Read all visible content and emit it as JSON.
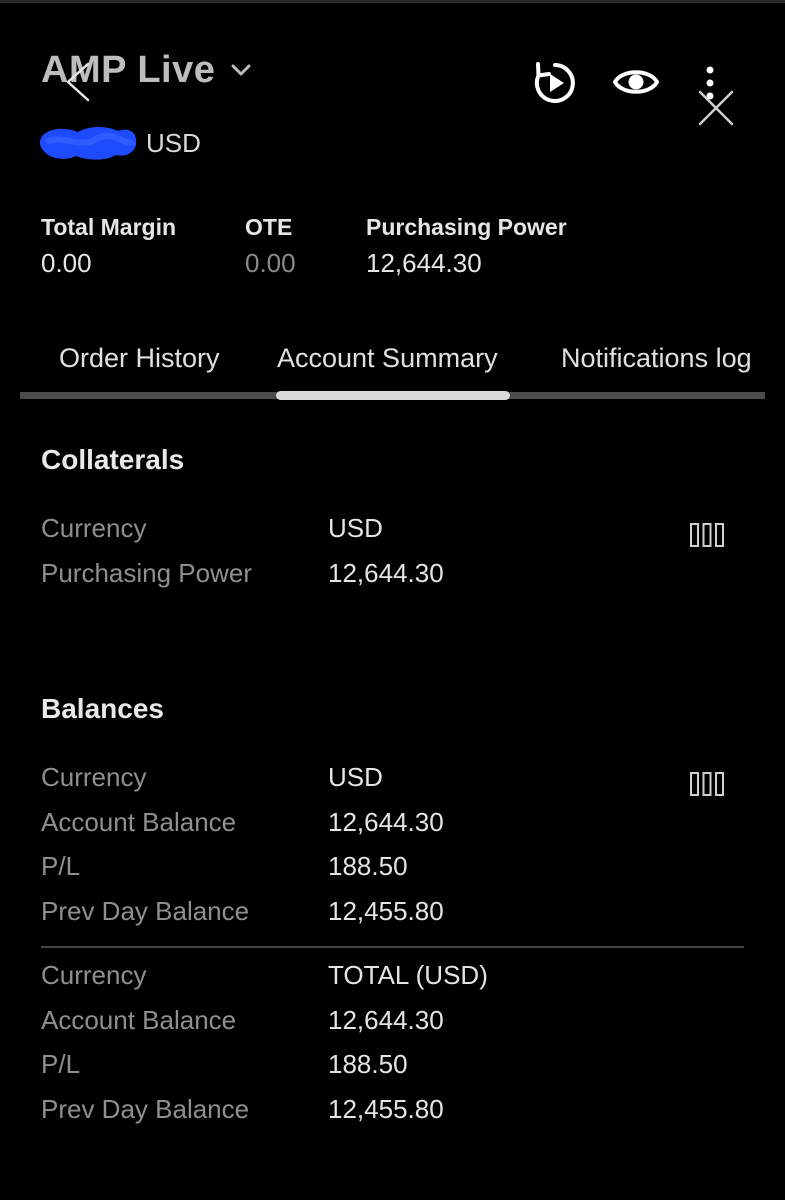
{
  "header": {
    "title": "AMP Live",
    "account_currency": "USD"
  },
  "stats": {
    "total_margin": {
      "label": "Total Margin",
      "value": "0.00"
    },
    "ote": {
      "label": "OTE",
      "value": "0.00"
    },
    "purchasing_power": {
      "label": "Purchasing Power",
      "value": "12,644.30"
    }
  },
  "tabs": [
    {
      "label": "Order History"
    },
    {
      "label": "Account Summary",
      "active": true
    },
    {
      "label": "Notifications log"
    }
  ],
  "collaterals": {
    "title": "Collaterals",
    "rows": [
      {
        "label": "Currency",
        "value": "USD"
      },
      {
        "label": "Purchasing Power",
        "value": "12,644.30"
      }
    ]
  },
  "balances": {
    "title": "Balances",
    "groups": [
      {
        "rows": [
          {
            "label": "Currency",
            "value": "USD"
          },
          {
            "label": "Account Balance",
            "value": "12,644.30"
          },
          {
            "label": "P/L",
            "value": "188.50"
          },
          {
            "label": "Prev Day Balance",
            "value": "12,455.80"
          }
        ]
      },
      {
        "rows": [
          {
            "label": "Currency",
            "value": "TOTAL (USD)"
          },
          {
            "label": "Account Balance",
            "value": "12,644.30"
          },
          {
            "label": "P/L",
            "value": "188.50"
          },
          {
            "label": "Prev Day Balance",
            "value": "12,455.80"
          }
        ]
      }
    ]
  },
  "icons": {
    "back": "chevron-left-icon",
    "title_caret": "chevron-down-icon",
    "replay": "replay-icon",
    "eye": "eye-icon",
    "more": "more-vertical-icon",
    "close": "close-icon",
    "columns": "columns-icon"
  },
  "colors": {
    "background": "#000000",
    "redaction": "#1f4bff",
    "active_tab_indicator": "#d9d9d9",
    "muted_text": "#8f8f8f"
  }
}
